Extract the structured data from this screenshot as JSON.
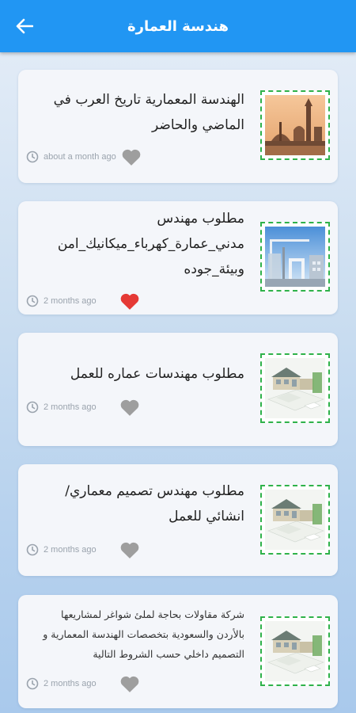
{
  "appbar": {
    "title": "هندسة العمارة",
    "back_icon": "arrow-left-icon",
    "color": "#2196f3"
  },
  "colors": {
    "heart_liked": "#e53935",
    "heart_default": "#9e9e9e",
    "thumb_border": "#2fb24a"
  },
  "posts": [
    {
      "title": "الهندسة المعمارية تاريخ العرب في الماضي والحاضر",
      "time": "about a month ago",
      "liked": false,
      "image": "city-skyline-image"
    },
    {
      "title": "مطلوب مهندس مدني_عمارة_كهرباء_ميكانيك_امن وبيئة_جوده",
      "time": "2 months ago",
      "liked": true,
      "image": "construction-crane-image"
    },
    {
      "title": "مطلوب مهندسات عماره للعمل",
      "time": "2 months ago",
      "liked": false,
      "image": "house-blueprint-image"
    },
    {
      "title": "مطلوب مهندس تصميم معماري/انشائي للعمل",
      "time": "2 months ago",
      "liked": false,
      "image": "house-blueprint-image"
    },
    {
      "title": "شركة مقاولات بحاجة لملئ شواغر لمشاريعها بالأردن والسعودية بتخصصات الهندسة المعمارية و التصميم داخلي حسب الشروط التالية",
      "time": "2 months ago",
      "liked": false,
      "image": "house-blueprint-image"
    }
  ]
}
